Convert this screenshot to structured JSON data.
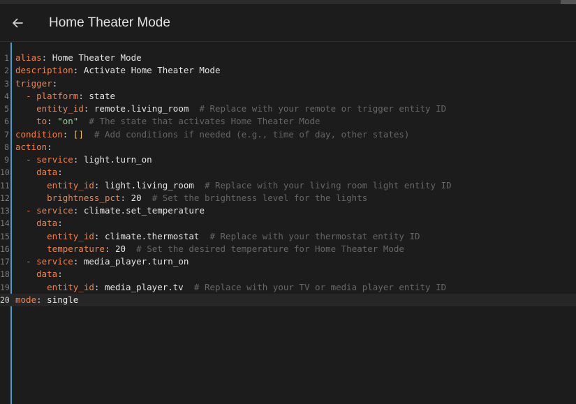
{
  "header": {
    "title": "Home Theater Mode",
    "back_icon": "arrow-left-icon"
  },
  "colors": {
    "background": "#1c1c1c",
    "key": "#f0824b",
    "string": "#8fd48a",
    "comment": "#666666",
    "cursor_bar": "#3aa0d8"
  },
  "editor": {
    "active_line": 20,
    "lines": [
      {
        "n": "1",
        "indent": "",
        "dash": "",
        "key": "alias",
        "val": "Home Theater Mode",
        "vtype": "v",
        "comment": ""
      },
      {
        "n": "2",
        "indent": "",
        "dash": "",
        "key": "description",
        "val": "Activate Home Theater Mode",
        "vtype": "v",
        "comment": ""
      },
      {
        "n": "3",
        "indent": "",
        "dash": "",
        "key": "trigger",
        "val": "",
        "vtype": "v",
        "comment": ""
      },
      {
        "n": "4",
        "indent": "  ",
        "dash": "- ",
        "key": "platform",
        "val": "state",
        "vtype": "v",
        "comment": ""
      },
      {
        "n": "5",
        "indent": "    ",
        "dash": "",
        "key": "entity_id",
        "val": "remote.living_room",
        "vtype": "v",
        "comment": "# Replace with your remote or trigger entity ID"
      },
      {
        "n": "6",
        "indent": "    ",
        "dash": "",
        "key": "to",
        "val": "\"on\"",
        "vtype": "s",
        "comment": "# The state that activates Home Theater Mode"
      },
      {
        "n": "7",
        "indent": "",
        "dash": "",
        "key": "condition",
        "val": "[]",
        "vtype": "b",
        "comment": "# Add conditions if needed (e.g., time of day, other states)"
      },
      {
        "n": "8",
        "indent": "",
        "dash": "",
        "key": "action",
        "val": "",
        "vtype": "v",
        "comment": ""
      },
      {
        "n": "9",
        "indent": "  ",
        "dash": "- ",
        "key": "service",
        "val": "light.turn_on",
        "vtype": "v",
        "comment": ""
      },
      {
        "n": "10",
        "indent": "    ",
        "dash": "",
        "key": "data",
        "val": "",
        "vtype": "v",
        "comment": ""
      },
      {
        "n": "11",
        "indent": "      ",
        "dash": "",
        "key": "entity_id",
        "val": "light.living_room",
        "vtype": "v",
        "comment": "# Replace with your living room light entity ID"
      },
      {
        "n": "12",
        "indent": "      ",
        "dash": "",
        "key": "brightness_pct",
        "val": "20",
        "vtype": "v",
        "comment": "# Set the brightness level for the lights"
      },
      {
        "n": "13",
        "indent": "  ",
        "dash": "- ",
        "key": "service",
        "val": "climate.set_temperature",
        "vtype": "v",
        "comment": ""
      },
      {
        "n": "14",
        "indent": "    ",
        "dash": "",
        "key": "data",
        "val": "",
        "vtype": "v",
        "comment": ""
      },
      {
        "n": "15",
        "indent": "      ",
        "dash": "",
        "key": "entity_id",
        "val": "climate.thermostat",
        "vtype": "v",
        "comment": "# Replace with your thermostat entity ID"
      },
      {
        "n": "16",
        "indent": "      ",
        "dash": "",
        "key": "temperature",
        "val": "20",
        "vtype": "v",
        "comment": "# Set the desired temperature for Home Theater Mode"
      },
      {
        "n": "17",
        "indent": "  ",
        "dash": "- ",
        "key": "service",
        "val": "media_player.turn_on",
        "vtype": "v",
        "comment": ""
      },
      {
        "n": "18",
        "indent": "    ",
        "dash": "",
        "key": "data",
        "val": "",
        "vtype": "v",
        "comment": ""
      },
      {
        "n": "19",
        "indent": "      ",
        "dash": "",
        "key": "entity_id",
        "val": "media_player.tv",
        "vtype": "v",
        "comment": "# Replace with your TV or media player entity ID"
      },
      {
        "n": "20",
        "indent": "",
        "dash": "",
        "key": "mode",
        "val": "single",
        "vtype": "v",
        "comment": ""
      }
    ]
  }
}
